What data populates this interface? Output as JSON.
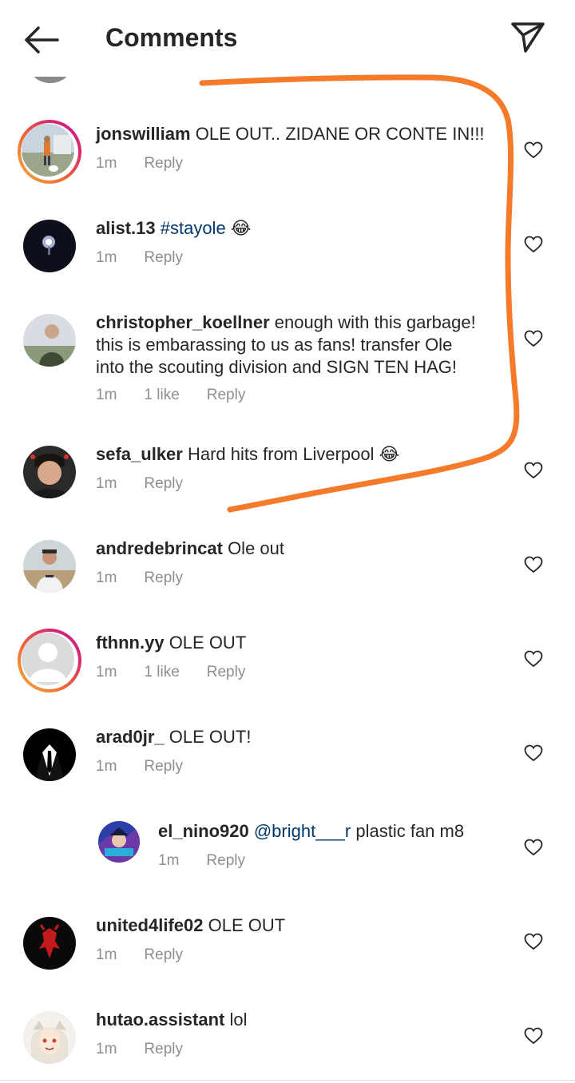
{
  "header": {
    "title": "Comments"
  },
  "comments": [
    {
      "username": "jonswilliam",
      "text": "OLE OUT.. ZIDANE OR CONTE IN!!!",
      "time": "1m",
      "reply": "Reply"
    },
    {
      "username": "alist.13",
      "mention": "#stayole",
      "text": " 😂",
      "time": "1m",
      "reply": "Reply"
    },
    {
      "username": "christopher_koellner",
      "text_line1": "enough with this garbage!",
      "text_line2": "this is embarassing to us as fans! transfer Ole",
      "text_line3": "into the scouting division and SIGN TEN HAG!",
      "time": "1m",
      "likes": "1 like",
      "reply": "Reply"
    },
    {
      "username": "sefa_ulker",
      "text": "Hard hits from Liverpool 😂",
      "time": "1m",
      "reply": "Reply"
    },
    {
      "username": "andredebrincat",
      "text": "Ole out",
      "time": "1m",
      "reply": "Reply"
    },
    {
      "username": "fthnn.yy",
      "text": "OLE OUT",
      "time": "1m",
      "likes": "1 like",
      "reply": "Reply"
    },
    {
      "username": "arad0jr_",
      "text": "OLE OUT!",
      "time": "1m",
      "reply": "Reply"
    },
    {
      "username": "el_nino920",
      "mention": "@bright___r",
      "text": " plastic fan m8",
      "time": "1m",
      "reply": "Reply"
    },
    {
      "username": "united4life02",
      "text": "OLE OUT",
      "time": "1m",
      "reply": "Reply"
    },
    {
      "username": "hutao.assistant",
      "text": "lol",
      "time": "1m",
      "reply": "Reply"
    }
  ],
  "icons": {
    "back": "arrow-left-icon",
    "send": "paper-plane-icon",
    "like": "heart-outline-icon"
  },
  "colors": {
    "annotation": "#f57a2a",
    "story_ring": "#d8276f",
    "mention": "#00376b",
    "meta": "#8e8e8e"
  }
}
